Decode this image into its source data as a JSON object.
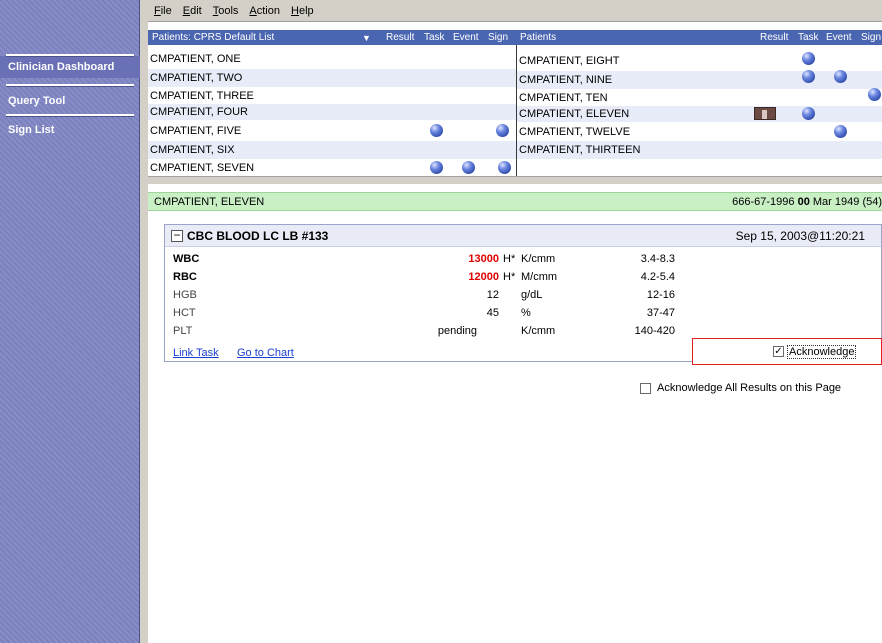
{
  "menu": [
    "File",
    "Edit",
    "Tools",
    "Action",
    "Help"
  ],
  "sidebar": [
    {
      "label": "Clinician Dashboard"
    },
    {
      "label": "Query Tool"
    },
    {
      "label": "Sign List"
    }
  ],
  "patient_list_left": {
    "header_title": "Patients: CPRS Default List",
    "columns": [
      "Result",
      "Task",
      "Event",
      "Sign"
    ],
    "rows": [
      {
        "name": "CMPATIENT, ONE"
      },
      {
        "name": "CMPATIENT, TWO"
      },
      {
        "name": "CMPATIENT, THREE"
      },
      {
        "name": "CMPATIENT, FOUR"
      },
      {
        "name": "CMPATIENT, FIVE"
      },
      {
        "name": "CMPATIENT, SIX"
      },
      {
        "name": "CMPATIENT, SEVEN"
      }
    ]
  },
  "patient_list_right": {
    "header_title": "Patients",
    "columns": [
      "Result",
      "Task",
      "Event",
      "Sign"
    ],
    "rows": [
      {
        "name": "CMPATIENT, EIGHT"
      },
      {
        "name": "CMPATIENT, NINE"
      },
      {
        "name": "CMPATIENT, TEN"
      },
      {
        "name": "CMPATIENT, ELEVEN"
      },
      {
        "name": "CMPATIENT, TWELVE"
      },
      {
        "name": "CMPATIENT, THIRTEEN"
      }
    ]
  },
  "detail": {
    "patient_name": "CMPATIENT, ELEVEN",
    "ssn": "666-67-1996",
    "dob_day": "00",
    "dob_rest": "Mar 1949",
    "age": "(54)"
  },
  "lab": {
    "title": "CBC BLOOD LC LB #133",
    "date": "Sep 15, 2003@11:20:21",
    "rows": [
      {
        "test": "WBC",
        "value": "13000",
        "flag": "H*",
        "units": "K/cmm",
        "range": "3.4-8.3"
      },
      {
        "test": "RBC",
        "value": "12000",
        "flag": "H*",
        "units": "M/cmm",
        "range": "4.2-5.4"
      },
      {
        "test": "HGB",
        "value": "12",
        "flag": "",
        "units": "g/dL",
        "range": "12-16"
      },
      {
        "test": "HCT",
        "value": "45",
        "flag": "",
        "units": "%",
        "range": "37-47"
      },
      {
        "test": "PLT",
        "value": "pending",
        "flag": "",
        "units": "K/cmm",
        "range": "140-420"
      }
    ],
    "link_task": "Link Task",
    "go_to_chart": "Go to Chart",
    "acknowledge": "Acknowledge",
    "acknowledge_checked": true
  },
  "acknowledge_all": "Acknowledge All Results on this Page",
  "acknowledge_all_checked": false
}
